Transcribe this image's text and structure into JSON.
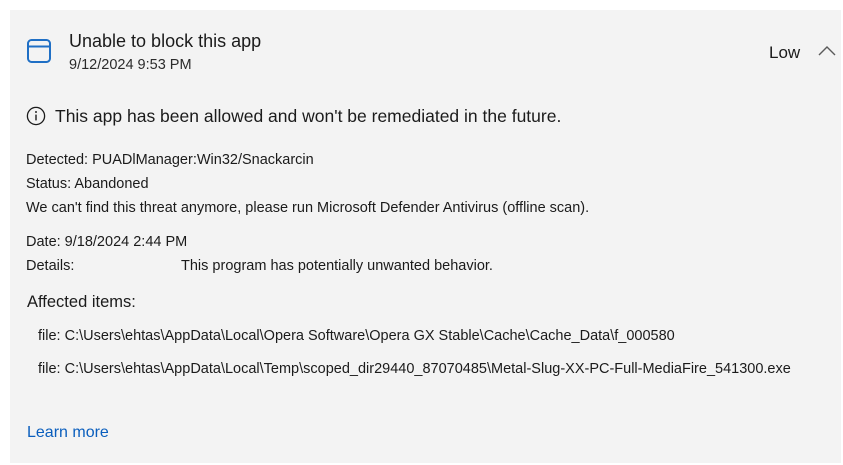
{
  "header": {
    "icon": "app-window-icon",
    "title": "Unable to block this app",
    "timestamp": "9/12/2024 9:53 PM",
    "severity": "Low",
    "collapse_icon": "chevron-up-icon"
  },
  "notice": {
    "icon": "info-circle-icon",
    "text": "This app has been allowed and won't be remediated in the future."
  },
  "threat": {
    "detected": "Detected: PUADlManager:Win32/Snackarcin",
    "status": "Status: Abandoned",
    "status_message": "We can't find this threat anymore, please run Microsoft Defender Antivirus (offline scan).",
    "date": "Date: 9/18/2024 2:44 PM",
    "details_label": "Details:",
    "details_value": "This program has potentially unwanted behavior."
  },
  "affected": {
    "title": "Affected items:",
    "items": [
      "file: C:\\Users\\ehtas\\AppData\\Local\\Opera Software\\Opera GX Stable\\Cache\\Cache_Data\\f_000580",
      "file: C:\\Users\\ehtas\\AppData\\Local\\Temp\\scoped_dir29440_87070485\\Metal-Slug-XX-PC-Full-MediaFire_541300.exe"
    ]
  },
  "footer": {
    "learn_more": "Learn more"
  },
  "colors": {
    "card_background": "#f3f3f3",
    "accent": "#0a5ebd",
    "icon_blue": "#1f6fc5"
  }
}
